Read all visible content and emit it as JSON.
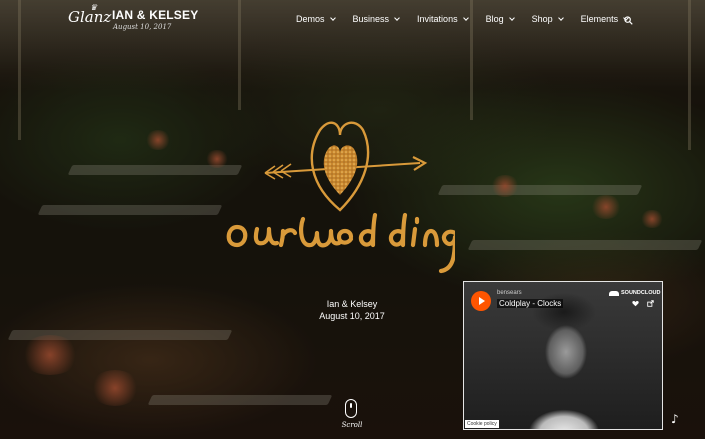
{
  "brand": {
    "logo_text": "Glanz",
    "name": "IAN & KELSEY",
    "date": "August 10, 2017"
  },
  "nav": {
    "items": [
      {
        "label": "Demos"
      },
      {
        "label": "Business"
      },
      {
        "label": "Invitations"
      },
      {
        "label": "Blog"
      },
      {
        "label": "Shop"
      },
      {
        "label": "Elements"
      }
    ],
    "search_icon": "search-icon"
  },
  "hero": {
    "art_text": "our wedding",
    "couple": "Ian & Kelsey",
    "date": "August 10, 2017",
    "scroll_label": "Scroll",
    "accent_color": "#d99a3a"
  },
  "soundcloud": {
    "user": "bensears",
    "track": "Coldplay - Clocks",
    "brand": "SOUNDCLOUD",
    "cookie": "Cookie policy",
    "play_color": "#ff5500"
  },
  "icons": {
    "music": "music-note-icon"
  }
}
